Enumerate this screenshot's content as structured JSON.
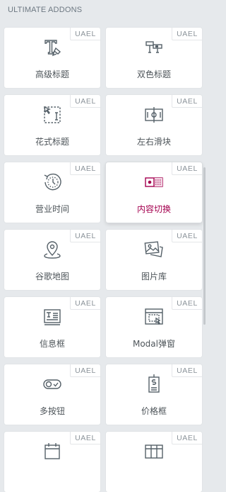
{
  "section": {
    "title": "ULTIMATE ADDONS"
  },
  "widgets": [
    {
      "label": "高级标题",
      "badge": "UAEL",
      "icon": "advanced-heading-icon"
    },
    {
      "label": "双色标题",
      "badge": "UAEL",
      "icon": "dual-color-heading-icon"
    },
    {
      "label": "花式标题",
      "badge": "UAEL",
      "icon": "fancy-heading-icon"
    },
    {
      "label": "左右滑块",
      "badge": "UAEL",
      "icon": "before-after-slider-icon"
    },
    {
      "label": "营业时间",
      "badge": "UAEL",
      "icon": "business-hours-icon"
    },
    {
      "label": "内容切换",
      "badge": "UAEL",
      "icon": "content-toggle-icon"
    },
    {
      "label": "谷歌地图",
      "badge": "UAEL",
      "icon": "google-map-icon"
    },
    {
      "label": "图片库",
      "badge": "UAEL",
      "icon": "image-gallery-icon"
    },
    {
      "label": "信息框",
      "badge": "UAEL",
      "icon": "info-box-icon"
    },
    {
      "label": "Modal弹窗",
      "badge": "UAEL",
      "icon": "modal-popup-icon"
    },
    {
      "label": "多按钮",
      "badge": "UAEL",
      "icon": "multi-buttons-icon"
    },
    {
      "label": "价格框",
      "badge": "UAEL",
      "icon": "price-box-icon"
    },
    {
      "label": "",
      "badge": "UAEL",
      "icon": "calendar-icon"
    },
    {
      "label": "",
      "badge": "UAEL",
      "icon": "table-icon"
    }
  ],
  "colors": {
    "background": "#e6e9ec",
    "accent": "#a4004f",
    "icon": "#556068"
  }
}
